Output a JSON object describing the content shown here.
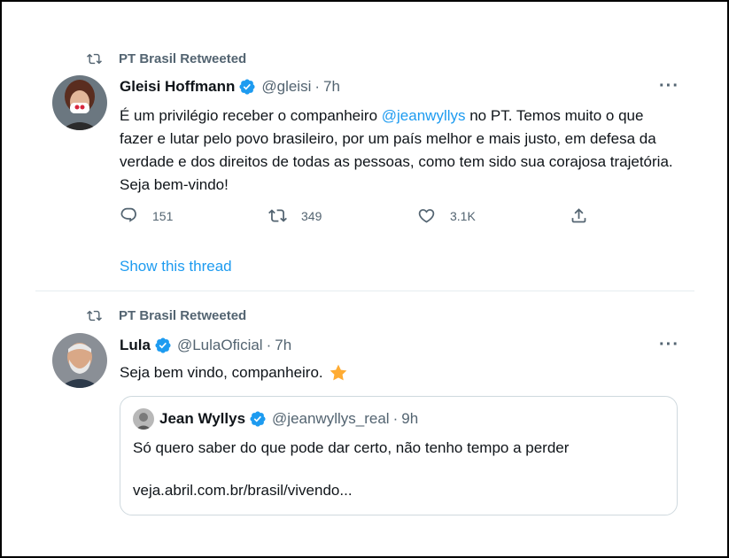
{
  "colors": {
    "accent": "#1d9bf0",
    "muted": "#536471",
    "text": "#0f1419",
    "star": "#ffac33"
  },
  "tweets": [
    {
      "retweet_label": "PT Brasil Retweeted",
      "author_name": "Gleisi Hoffmann",
      "author_handle": "@gleisi",
      "time": "7h",
      "more": "···",
      "text_part1": "É um privilégio receber o companheiro ",
      "mention": "@jeanwyllys",
      "text_part2": " no PT. Temos muito o que fazer e lutar pelo povo brasileiro, por um país melhor e mais justo, em defesa da verdade e dos direitos de todas as pessoas, como tem sido sua corajosa trajetória. Seja bem-vindo!",
      "replies": "151",
      "retweets": "349",
      "likes": "3.1K",
      "show_thread": "Show this thread",
      "icons": [
        "retweet-icon",
        "verified-icon",
        "more-icon",
        "reply-icon",
        "like-icon",
        "share-icon"
      ]
    },
    {
      "retweet_label": "PT Brasil Retweeted",
      "author_name": "Lula",
      "author_handle": "@LulaOficial",
      "time": "7h",
      "more": "···",
      "text": "Seja bem vindo, companheiro.",
      "emoji": "star-icon",
      "quote": {
        "author_name": "Jean Wyllys",
        "author_handle": "@jeanwyllys_real",
        "time": "9h",
        "text": "Só quero saber do que pode dar certo, não tenho tempo a perder",
        "link": "veja.abril.com.br/brasil/vivendo..."
      }
    }
  ]
}
